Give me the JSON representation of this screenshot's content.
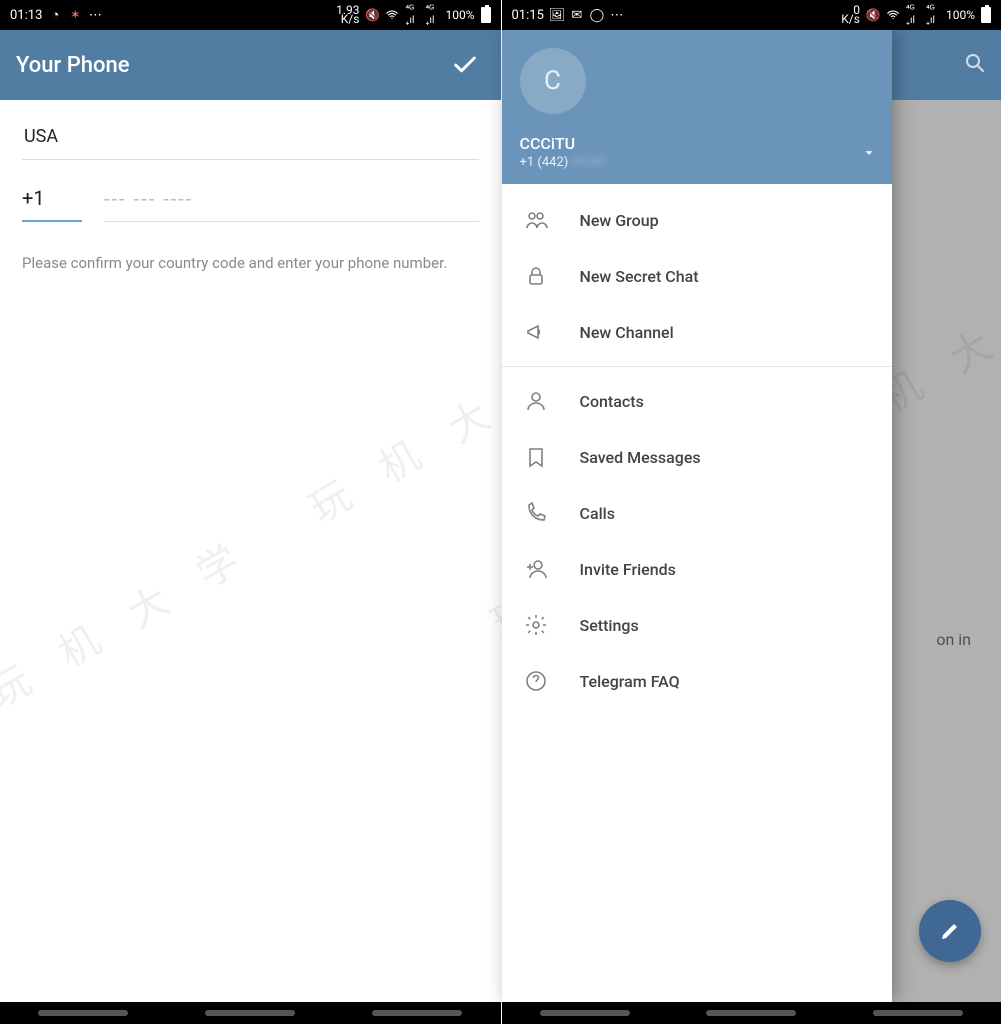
{
  "phone1": {
    "status": {
      "time": "01:13",
      "netspeed": "1.93\nK/s",
      "battery": "100%"
    },
    "title": "Your Phone",
    "country": "USA",
    "code": "+1",
    "phone_placeholder": "--- --- ----",
    "hint": "Please confirm your country code and enter your phone number."
  },
  "phone2": {
    "status": {
      "time": "01:15",
      "netspeed": "0\nK/s",
      "battery": "100%"
    },
    "drawer": {
      "avatar_initial": "C",
      "name": "CCCiTU",
      "phone_prefix": "+1 (442)",
      "phone_rest": " ••• ••••",
      "items": [
        {
          "label": "New Group",
          "icon": "group"
        },
        {
          "label": "New Secret Chat",
          "icon": "lock"
        },
        {
          "label": "New Channel",
          "icon": "megaphone"
        },
        {
          "divider": true
        },
        {
          "label": "Contacts",
          "icon": "person"
        },
        {
          "label": "Saved Messages",
          "icon": "bookmark"
        },
        {
          "label": "Calls",
          "icon": "phone"
        },
        {
          "label": "Invite Friends",
          "icon": "invite"
        },
        {
          "label": "Settings",
          "icon": "gear"
        },
        {
          "label": "Telegram FAQ",
          "icon": "help"
        }
      ]
    },
    "bg_fragment": "on in"
  }
}
